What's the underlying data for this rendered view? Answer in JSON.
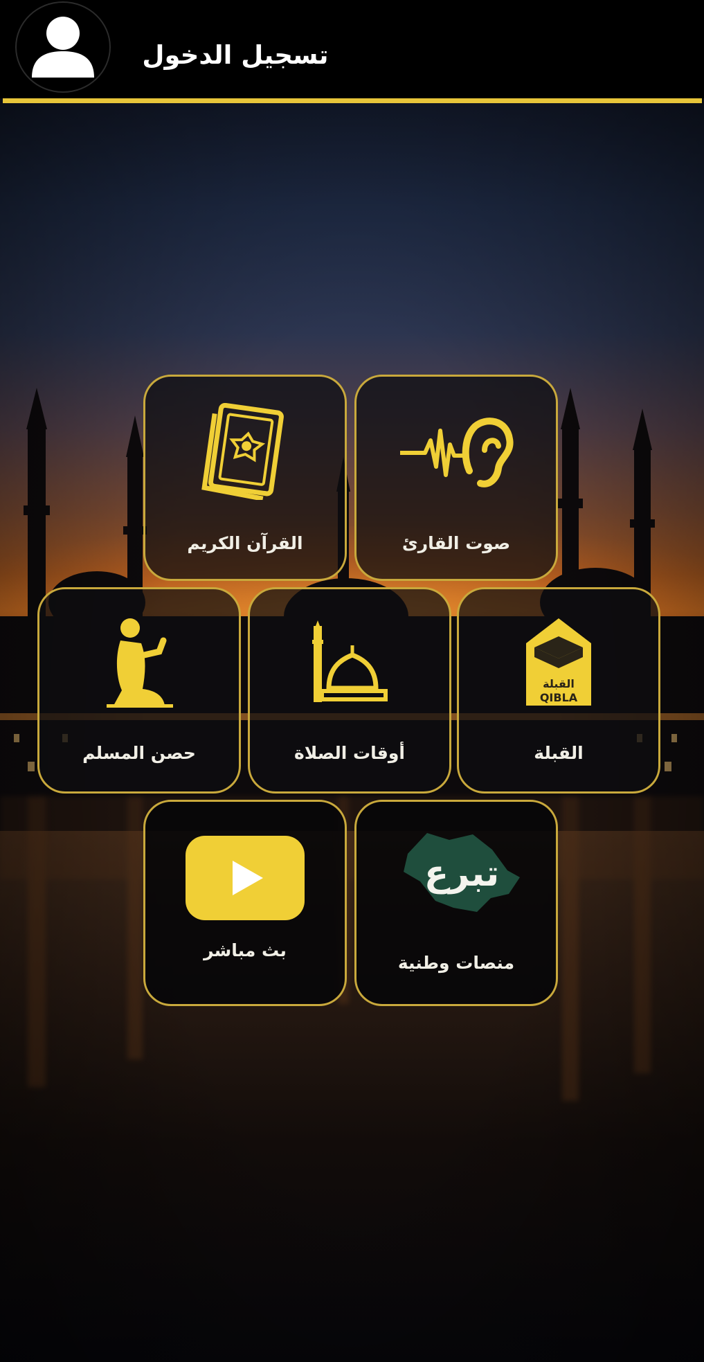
{
  "header": {
    "login_label": "تسجيل الدخول"
  },
  "colors": {
    "accent": "#e7c53a",
    "tile_border": "#c9a93c",
    "header_bg": "#000000",
    "tile_label": "#f1efe6",
    "tabaru_green": "#1f4e3d"
  },
  "tiles": [
    {
      "label": "صوت القارئ",
      "icon": "ear-soundwave-icon"
    },
    {
      "label": "القرآن الكريم",
      "icon": "quran-book-icon"
    },
    {
      "label": "القبلة",
      "icon": "kaaba-qibla-icon",
      "badge_ar": "القبلة",
      "badge_en": "QIBLA"
    },
    {
      "label": "أوقات الصلاة",
      "icon": "mosque-icon"
    },
    {
      "label": "حصن المسلم",
      "icon": "praying-man-icon"
    },
    {
      "label": "منصات وطنية",
      "icon": "tabaru-logo-icon",
      "logo_text": "تبرع"
    },
    {
      "label": "بث مباشر",
      "icon": "play-button-icon"
    }
  ]
}
